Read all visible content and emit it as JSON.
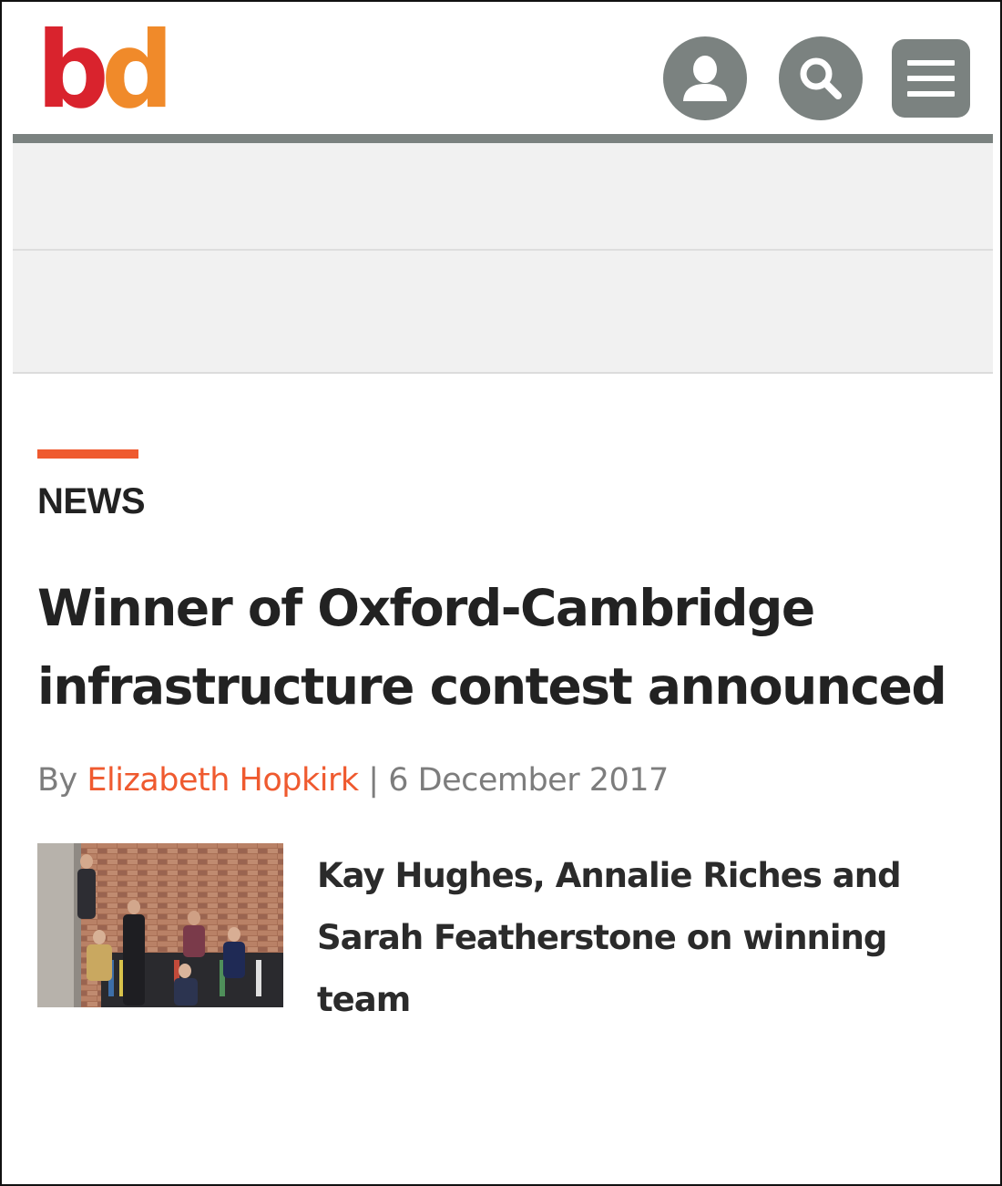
{
  "header": {
    "logo": {
      "letter_b": "b",
      "letter_d": "d",
      "color_b": "#d9232d",
      "color_d": "#f08a2a"
    },
    "icons": [
      "user-icon",
      "search-icon",
      "menu-icon"
    ],
    "icon_color": "#7b8280"
  },
  "article": {
    "category": "NEWS",
    "headline": "Winner of Oxford-Cambridge infrastructure contest announced",
    "byline": {
      "prefix": "By",
      "author": "Elizabeth Hopkirk",
      "separator": "|",
      "date": "6 December 2017"
    },
    "accent_color": "#ef5a2f"
  },
  "related": {
    "title": "Kay Hughes, Annalie Riches and Sarah Featherstone on winning team"
  }
}
